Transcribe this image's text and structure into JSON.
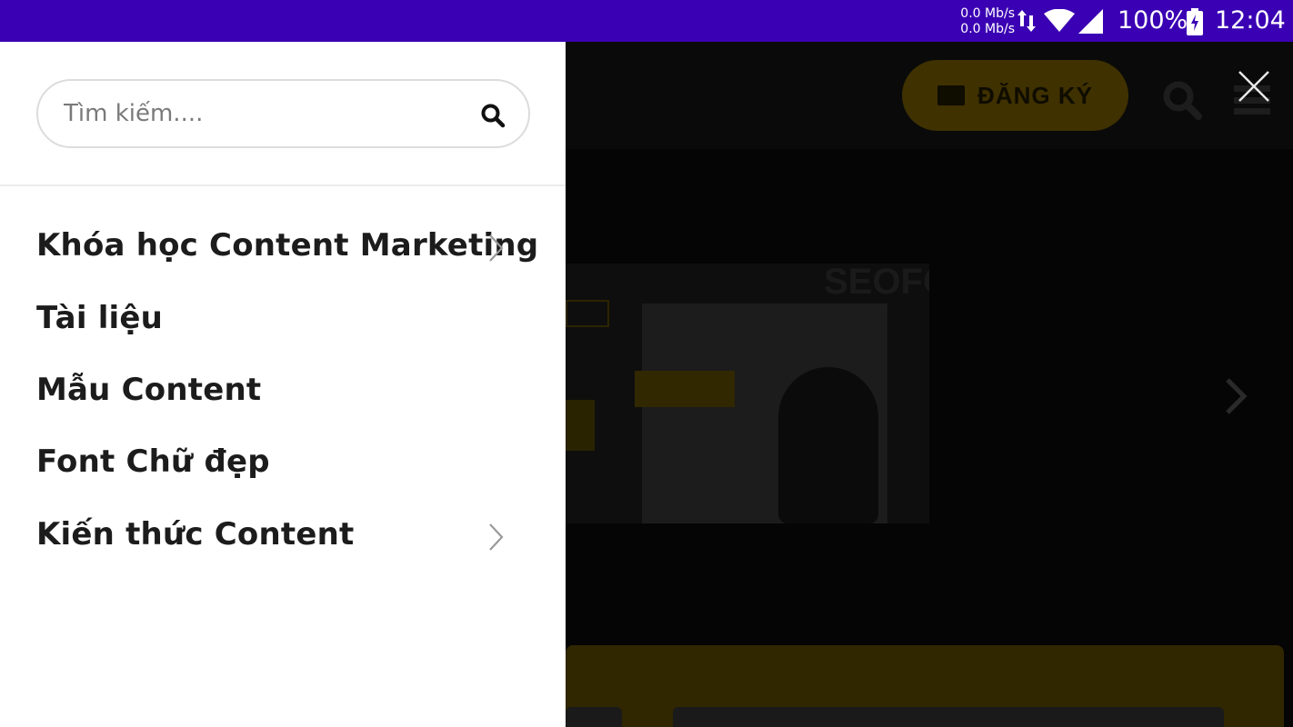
{
  "status_bar": {
    "net_up": "0.0 Mb/s",
    "net_down": "0.0 Mb/s",
    "battery_percent": "100%",
    "time": "12:04",
    "icons": [
      "data-arrows-icon",
      "wifi-icon",
      "signal-icon",
      "battery-charging-icon"
    ]
  },
  "background_page": {
    "signup_label": "ĐĂNG KÝ",
    "banner_vertical_text": "SEOFOU",
    "icons": [
      "mail-icon",
      "search-icon",
      "menu-icon",
      "chevron-right-icon",
      "close-icon"
    ]
  },
  "drawer": {
    "search": {
      "placeholder": "Tìm kiếm....",
      "value": ""
    },
    "menu": [
      {
        "label": "Khóa học Content Marketing",
        "has_submenu": true
      },
      {
        "label": "Tài liệu",
        "has_submenu": false
      },
      {
        "label": "Mẫu Content",
        "has_submenu": false
      },
      {
        "label": "Font Chữ đẹp",
        "has_submenu": false
      },
      {
        "label": "Kiến thức Content",
        "has_submenu": true
      }
    ]
  },
  "colors": {
    "status_bar": "#3a00b3",
    "drawer_bg": "#ffffff",
    "menu_text": "#1c1c1c",
    "accent_yellow": "#f5c400"
  }
}
